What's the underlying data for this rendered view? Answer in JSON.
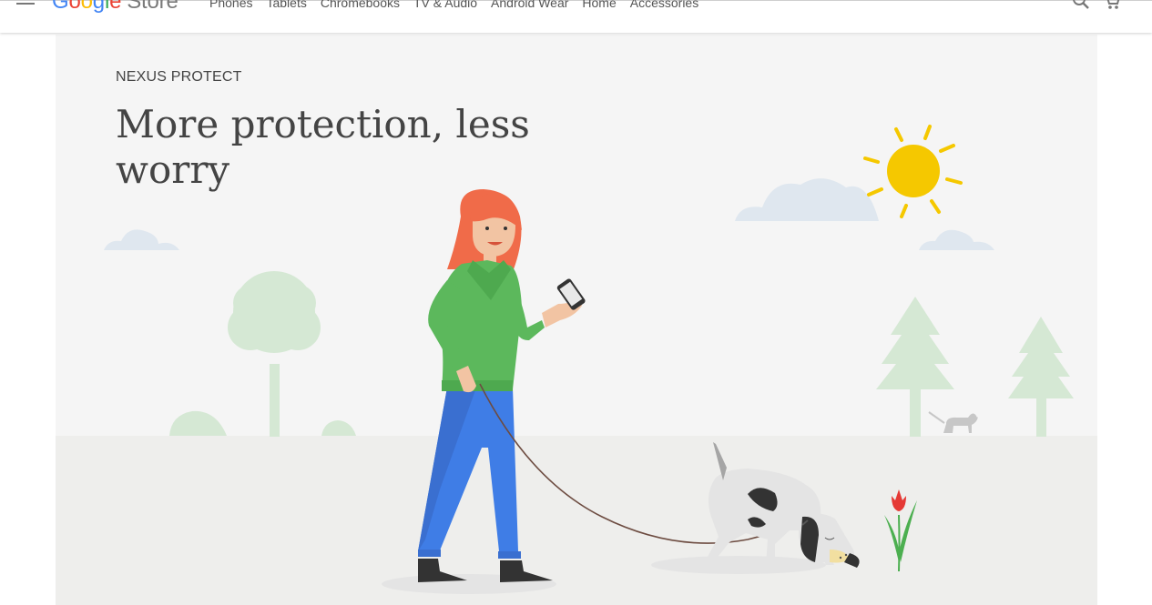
{
  "header": {
    "logo": {
      "google_letters": [
        "G",
        "o",
        "o",
        "g",
        "l",
        "e"
      ],
      "store": "Store"
    },
    "nav": [
      "Phones",
      "Tablets",
      "Chromebooks",
      "TV & Audio",
      "Android Wear",
      "Home",
      "Accessories"
    ]
  },
  "hero": {
    "eyebrow": "NEXUS PROTECT",
    "headline": "More protection, less worry"
  },
  "colors": {
    "google_blue": "#4285f4",
    "google_red": "#ea4335",
    "google_yellow": "#fbbc05",
    "google_green": "#34a853",
    "hero_bg": "#f5f5f5",
    "ground": "#eeeeec",
    "sun": "#f5c800",
    "tree": "#d5e8d4",
    "cloud": "#dfe7ef"
  }
}
